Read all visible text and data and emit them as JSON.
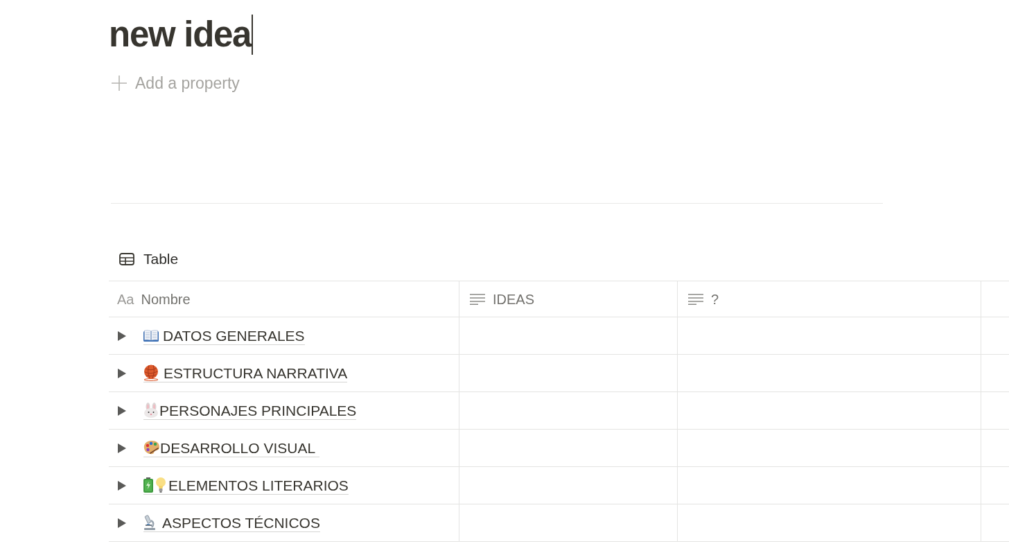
{
  "page": {
    "title": {
      "value": "new idea",
      "focused": true
    },
    "add_property": {
      "label": "Add a property"
    }
  },
  "view": {
    "label": "Table"
  },
  "table": {
    "columns": [
      {
        "kind": "title",
        "type_glyph": "Aa",
        "label": "Nombre"
      },
      {
        "kind": "text",
        "label": "IDEAS"
      },
      {
        "kind": "text",
        "label": "?"
      }
    ],
    "rows": [
      {
        "name": "DATOS GENERALES",
        "expanded": false
      },
      {
        "name": "ESTRUCTURA NARRATIVA",
        "expanded": false
      },
      {
        "name": "PERSONAJES PRINCIPALES",
        "expanded": false
      },
      {
        "name": "DESARROLLO VISUAL",
        "expanded": false
      },
      {
        "name": "ELEMENTOS LITERARIOS",
        "expanded": false
      },
      {
        "name": "ASPECTOS TÉCNICOS",
        "expanded": false
      }
    ]
  }
}
